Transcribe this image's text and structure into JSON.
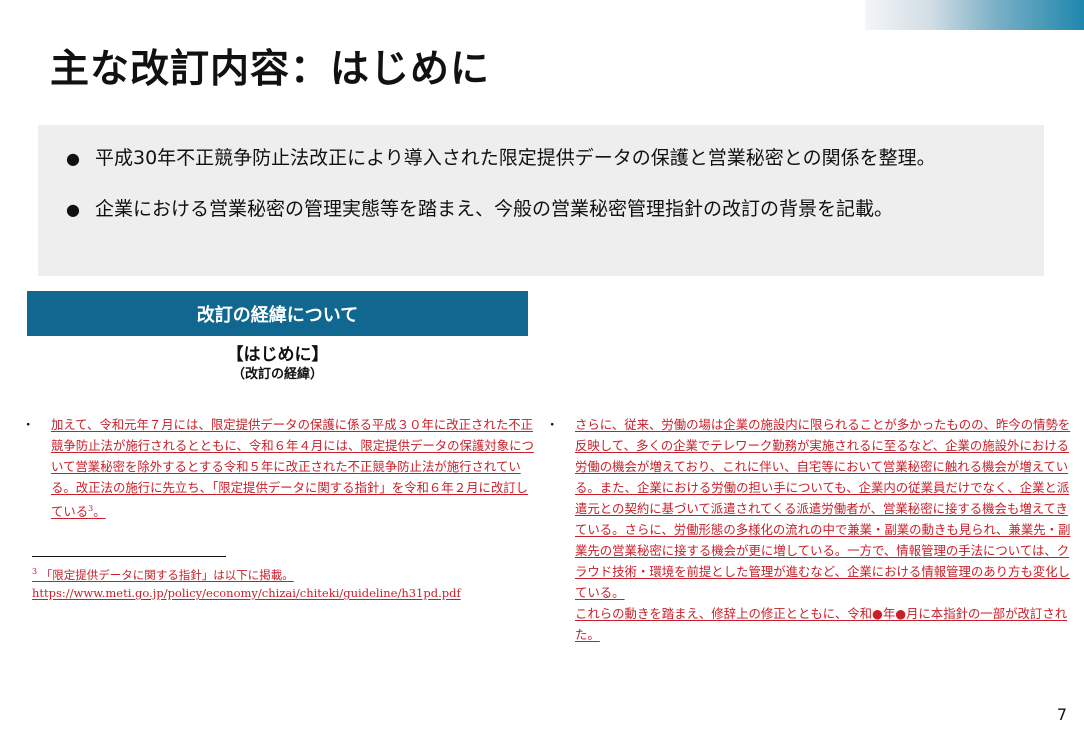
{
  "title": "主な改訂内容：はじめに",
  "summary": {
    "bullets": [
      "平成30年不正競争防止法改正により導入された限定提供データの保護と営業秘密との関係を整理。",
      "企業における営業秘密の管理実態等を踏まえ、今般の営業秘密管理指針の改訂の背景を記載。"
    ]
  },
  "section": {
    "header": "改訂の経緯について",
    "doc_heading": "【はじめに】",
    "doc_subheading": "（改訂の経緯）",
    "bullet_symbol": "・",
    "left_paragraph": "加えて、令和元年７月には、限定提供データの保護に係る平成３０年に改正された不正競争防止法が施行されるとともに、令和６年４月には、限定提供データの保護対象について営業秘密を除外するとする令和５年に改正された不正競争防止法が施行されている。改正法の施行に先立ち、「限定提供データに関する指針」を令和６年２月に改訂している",
    "left_footnote_ref": "3",
    "left_paragraph_end": "。",
    "right_paragraph_1": "さらに、従来、労働の場は企業の施設内に限られることが多かったものの、昨今の情勢を反映して、多くの企業でテレワーク勤務が実施されるに至るなど、企業の施設外における労働の機会が増えており、これに伴い、自宅等において営業秘密に触れる機会が増えている。また、企業における労働の担い手についても、企業内の従業員だけでなく、企業と派遣元との契約に基づいて派遣されてくる派遣労働者が、営業秘密に接する機会も増えてきている。さらに、労働形態の多様化の流れの中で兼業・副業の動きも見られ、兼業先・副業先の営業秘密に接する機会が更に増している。一方で、情報管理の手法については、クラウド技術・環境を前提とした管理が進むなど、企業における情報管理のあり方も変化している。",
    "right_paragraph_2": "これらの動きを踏まえ、修辞上の修正とともに、令和●年●月に本指針の一部が改訂された。",
    "footnote_number": "3",
    "footnote_text": "「限定提供データに関する指針」は以下に掲載。",
    "footnote_url": "https://www.meti.go.jp/policy/economy/chizai/chiteki/guideline/h31pd.pdf"
  },
  "page_number": "7",
  "colors": {
    "accent": "#10678f",
    "revision_red": "#c8202a",
    "summary_bg": "#eeeeef"
  }
}
